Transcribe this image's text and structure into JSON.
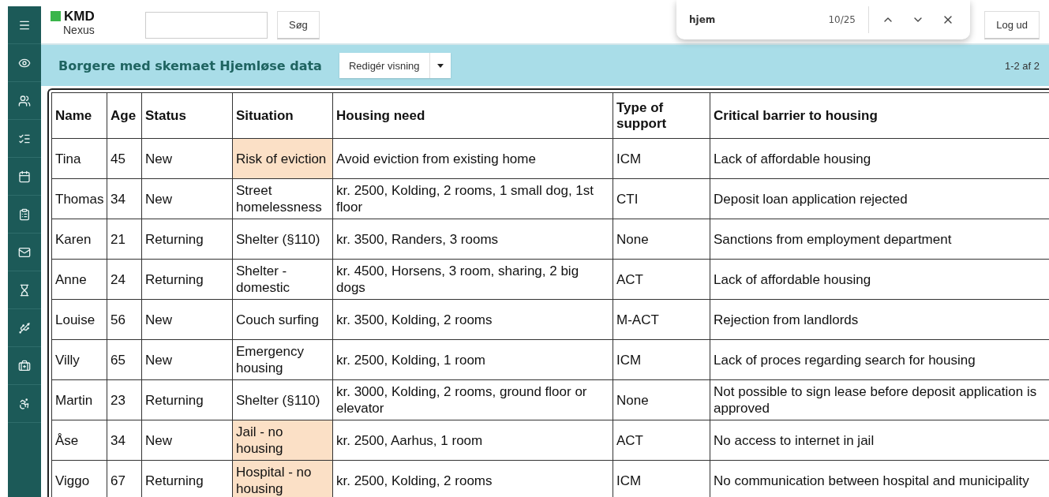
{
  "logo": {
    "brand": "KMD",
    "product": "Nexus"
  },
  "search": {
    "button": "Søg"
  },
  "find_bar": {
    "query": "hjem",
    "count": "10/25"
  },
  "logout": "Log ud",
  "view": {
    "title": "Borgere med skemaet Hjemløse data",
    "edit_button": "Redigér visning",
    "range": "1-2 af 2"
  },
  "table": {
    "columns": [
      "Name",
      "Age",
      "Status",
      "Situation",
      "Housing need",
      "Type of support",
      "Critical barrier to housing"
    ],
    "rows": [
      {
        "cells": [
          "Tina",
          "45",
          "New",
          "Risk of eviction",
          "Avoid eviction from existing home",
          "ICM",
          "Lack of affordable housing"
        ],
        "highlighted": true
      },
      {
        "cells": [
          "Thomas",
          "34",
          "New",
          "Street homelessness",
          "kr. 2500, Kolding, 2 rooms, 1 small dog, 1st floor",
          "CTI",
          "Deposit loan application rejected"
        ],
        "highlighted": false
      },
      {
        "cells": [
          "Karen",
          "21",
          "Returning",
          "Shelter (§110)",
          "kr. 3500, Randers, 3 rooms",
          "None",
          "Sanctions from employment department"
        ],
        "highlighted": false
      },
      {
        "cells": [
          "Anne",
          "24",
          "Returning",
          "Shelter - domestic",
          "kr. 4500, Horsens, 3 room, sharing, 2 big dogs",
          "ACT",
          "Lack of affordable housing"
        ],
        "highlighted": false
      },
      {
        "cells": [
          "Louise",
          "56",
          "New",
          "Couch surfing",
          "kr. 3500, Kolding, 2 rooms",
          "M-ACT",
          "Rejection from landlords"
        ],
        "highlighted": false
      },
      {
        "cells": [
          "Villy",
          "65",
          "New",
          "Emergency housing",
          "kr. 2500, Kolding, 1 room",
          "ICM",
          "Lack of proces regarding search for housing"
        ],
        "highlighted": false
      },
      {
        "cells": [
          "Martin",
          "23",
          "Returning",
          "Shelter (§110)",
          "kr. 3000, Kolding, 2 rooms, ground floor or elevator",
          "None",
          "Not possible to sign lease before deposit application is approved"
        ],
        "highlighted": false
      },
      {
        "cells": [
          "Åse",
          "34",
          "New",
          "Jail - no housing",
          "kr. 2500, Aarhus, 1 room",
          "ACT",
          "No access to internet in jail"
        ],
        "highlighted": true
      },
      {
        "cells": [
          "Viggo",
          "67",
          "Returning",
          "Hospital - no housing",
          "kr. 2500, Kolding, 2 rooms",
          "ICM",
          "No communication between hospital and municipality"
        ],
        "highlighted": true
      }
    ]
  }
}
